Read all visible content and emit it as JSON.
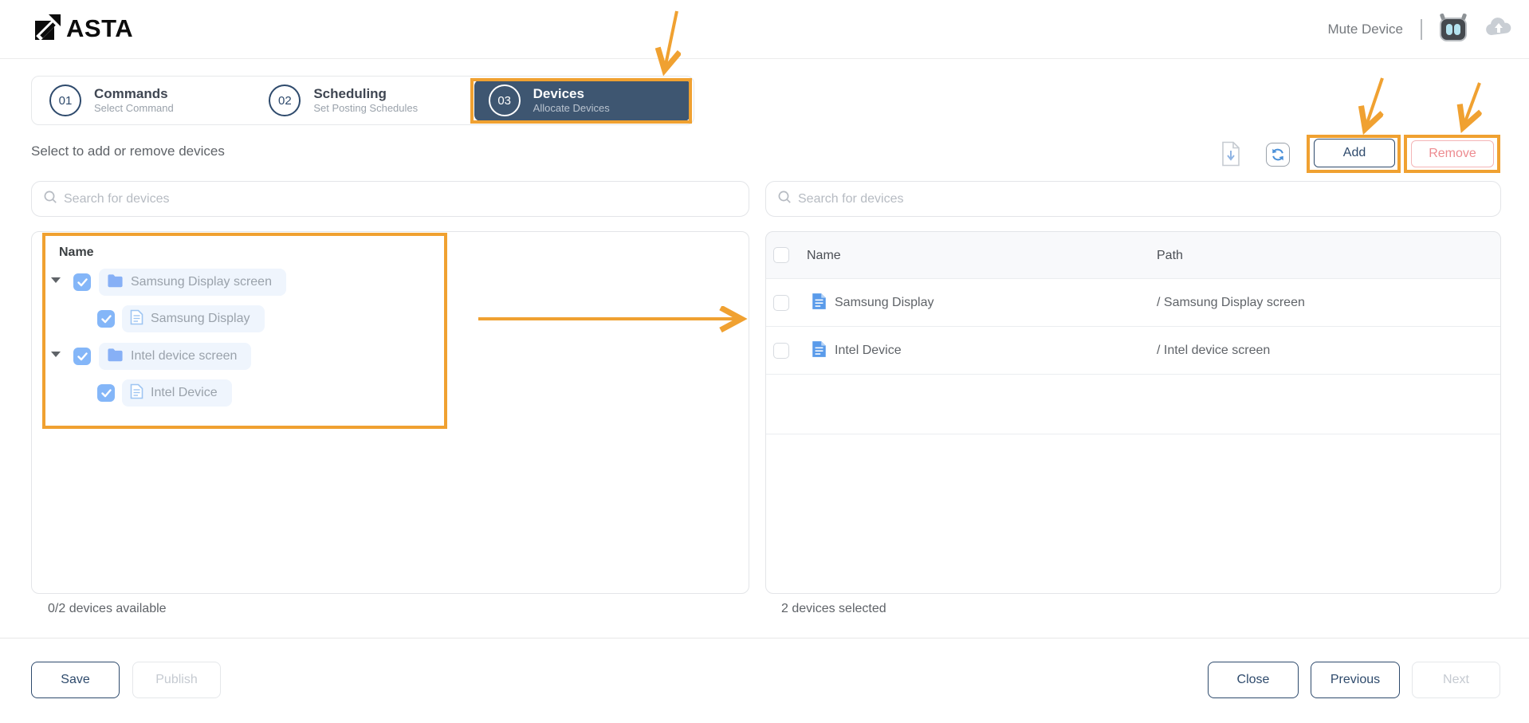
{
  "header": {
    "brand": "ASTA",
    "mute_label": "Mute Device"
  },
  "steps": [
    {
      "num": "01",
      "title": "Commands",
      "subtitle": "Select Command"
    },
    {
      "num": "02",
      "title": "Scheduling",
      "subtitle": "Set Posting Schedules"
    },
    {
      "num": "03",
      "title": "Devices",
      "subtitle": "Allocate Devices"
    }
  ],
  "toolbar": {
    "instruction": "Select to add or remove devices",
    "add_label": "Add",
    "remove_label": "Remove"
  },
  "left_panel": {
    "search_placeholder": "Search for devices",
    "header": "Name",
    "tree": [
      {
        "label": "Samsung Display screen",
        "type": "folder",
        "checked": true,
        "children": [
          {
            "label": "Samsung Display",
            "type": "device",
            "checked": true
          }
        ]
      },
      {
        "label": "Intel device screen",
        "type": "folder",
        "checked": true,
        "children": [
          {
            "label": "Intel Device",
            "type": "device",
            "checked": true
          }
        ]
      }
    ],
    "footer": "0/2 devices available"
  },
  "right_panel": {
    "search_placeholder": "Search for devices",
    "columns": {
      "name": "Name",
      "path": "Path"
    },
    "rows": [
      {
        "name": "Samsung Display",
        "path": "/ Samsung Display screen",
        "checked": false
      },
      {
        "name": "Intel Device",
        "path": "/ Intel device screen",
        "checked": false
      }
    ],
    "footer": "2 devices selected"
  },
  "footer": {
    "save": "Save",
    "publish": "Publish",
    "close": "Close",
    "previous": "Previous",
    "next": "Next"
  },
  "icons": {
    "logo": "arrow-up-right-square",
    "bot": "robot-avatar",
    "cloud": "cloud-upload",
    "download": "file-download",
    "refresh": "sync-arrows",
    "search": "magnifier",
    "folder": "folder",
    "device": "document",
    "caret": "triangle-down",
    "check": "checkmark"
  },
  "colors": {
    "navy": "#2e4a6c",
    "active_tab_bg": "#3e5671",
    "annotation_orange": "#f0a131",
    "remove_red": "#ed8b90",
    "checkbox_blue": "#84b6f8",
    "link_blue": "#4a90d9"
  }
}
